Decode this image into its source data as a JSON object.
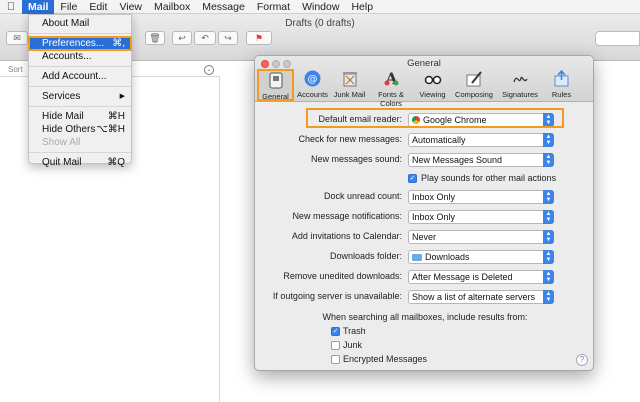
{
  "menubar": {
    "items": [
      "Mail",
      "File",
      "Edit",
      "View",
      "Mailbox",
      "Message",
      "Format",
      "Window",
      "Help"
    ]
  },
  "mail_window": {
    "title": "Drafts (0 drafts)",
    "sort_label": "Sort"
  },
  "mail_menu": {
    "items": [
      {
        "label": "About Mail",
        "shortcut": ""
      },
      {
        "label": "Preferences...",
        "shortcut": "⌘,"
      },
      {
        "label": "Accounts...",
        "shortcut": ""
      },
      {
        "label": "Add Account...",
        "shortcut": ""
      },
      {
        "label": "Services",
        "shortcut": "▶"
      },
      {
        "label": "Hide Mail",
        "shortcut": "⌘H"
      },
      {
        "label": "Hide Others",
        "shortcut": "⌥⌘H"
      },
      {
        "label": "Show All",
        "shortcut": ""
      },
      {
        "label": "Quit Mail",
        "shortcut": "⌘Q"
      }
    ]
  },
  "prefs": {
    "title": "General",
    "tabs": [
      {
        "label": "General",
        "icon": "switch-icon"
      },
      {
        "label": "Accounts",
        "icon": "at-icon"
      },
      {
        "label": "Junk Mail",
        "icon": "trash-icon"
      },
      {
        "label": "Fonts & Colors",
        "icon": "font-icon"
      },
      {
        "label": "Viewing",
        "icon": "glasses-icon"
      },
      {
        "label": "Composing",
        "icon": "pen-icon"
      },
      {
        "label": "Signatures",
        "icon": "signature-icon"
      },
      {
        "label": "Rules",
        "icon": "rules-icon"
      }
    ],
    "rows": [
      {
        "label": "Default email reader:",
        "value": "Google Chrome"
      },
      {
        "label": "Check for new messages:",
        "value": "Automatically"
      },
      {
        "label": "New messages sound:",
        "value": "New Messages Sound"
      },
      {
        "label": "Dock unread count:",
        "value": "Inbox Only"
      },
      {
        "label": "New message notifications:",
        "value": "Inbox Only"
      },
      {
        "label": "Add invitations to Calendar:",
        "value": "Never"
      },
      {
        "label": "Downloads folder:",
        "value": "Downloads"
      },
      {
        "label": "Remove unedited downloads:",
        "value": "After Message is Deleted"
      },
      {
        "label": "If outgoing server is unavailable:",
        "value": "Show a list of alternate servers"
      }
    ],
    "play_sounds_label": "Play sounds for other mail actions",
    "search_caption": "When searching all mailboxes, include results from:",
    "search_options": [
      {
        "label": "Trash",
        "checked": true
      },
      {
        "label": "Junk",
        "checked": false
      },
      {
        "label": "Encrypted Messages",
        "checked": false
      }
    ],
    "help": "?"
  }
}
